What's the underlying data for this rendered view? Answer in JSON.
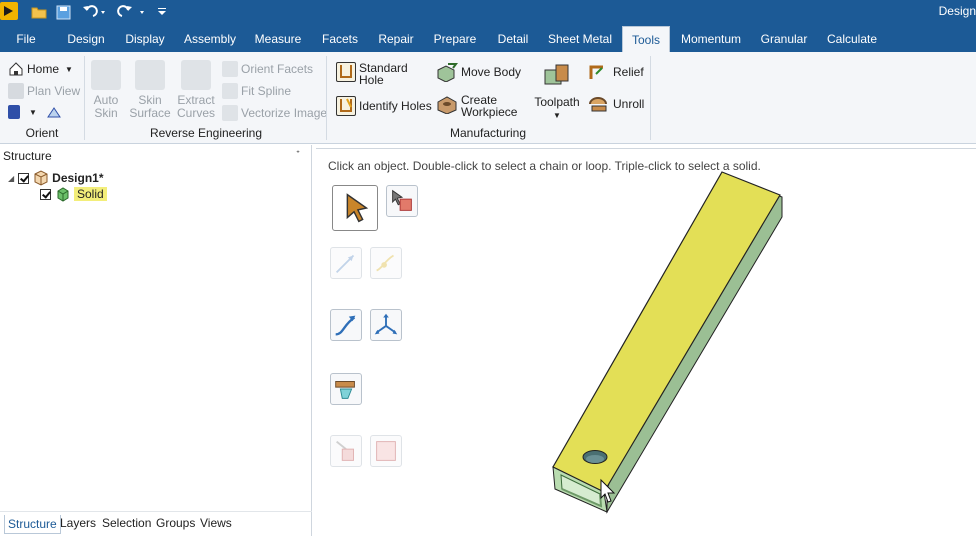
{
  "window": {
    "title": "Design"
  },
  "quick_access": {
    "icons": [
      "app-logo-icon",
      "open-folder-icon",
      "save-icon",
      "undo-icon",
      "redo-icon",
      "customize-icon"
    ]
  },
  "menu": {
    "tabs": [
      {
        "label": "File"
      },
      {
        "label": "Design"
      },
      {
        "label": "Display"
      },
      {
        "label": "Assembly"
      },
      {
        "label": "Measure"
      },
      {
        "label": "Facets"
      },
      {
        "label": "Repair"
      },
      {
        "label": "Prepare"
      },
      {
        "label": "Detail"
      },
      {
        "label": "Sheet Metal"
      },
      {
        "label": "Tools"
      },
      {
        "label": "Momentum"
      },
      {
        "label": "Granular"
      },
      {
        "label": "Calculate"
      }
    ],
    "active_tab": "Tools"
  },
  "ribbon": {
    "orient": {
      "label": "Orient",
      "home": "Home",
      "plan_view": "Plan View"
    },
    "reverse_engineering": {
      "label": "Reverse Engineering",
      "auto_skin": "Auto\nSkin",
      "skin_surface": "Skin\nSurface",
      "extract_curves": "Extract\nCurves",
      "orient_facets": "Orient Facets",
      "fit_spline": "Fit Spline",
      "vectorize_image": "Vectorize Image"
    },
    "manufacturing": {
      "label": "Manufacturing",
      "standard_hole": "Standard\nHole",
      "identify_holes": "Identify Holes",
      "move_body": "Move Body",
      "create_workpiece": "Create\nWorkpiece",
      "toolpath": "Toolpath",
      "relief": "Relief",
      "unroll": "Unroll"
    }
  },
  "structure": {
    "title": "Structure",
    "tree": [
      {
        "label": "Design1*",
        "checked": true,
        "level": 0
      },
      {
        "label": "Solid",
        "checked": true,
        "level": 1
      }
    ],
    "bottom_tabs": [
      {
        "label": "Structure"
      },
      {
        "label": "Layers"
      },
      {
        "label": "Selection"
      },
      {
        "label": "Groups"
      },
      {
        "label": "Views"
      }
    ],
    "active_bottom_tab": "Structure"
  },
  "canvas": {
    "hint": "Click an object.  Double-click to select a chain or loop.  Triple-click to select a solid.",
    "colors": {
      "top_face": "#e3df56",
      "side_face": "#9bbf94",
      "end_face": "#b9dcb0"
    }
  }
}
